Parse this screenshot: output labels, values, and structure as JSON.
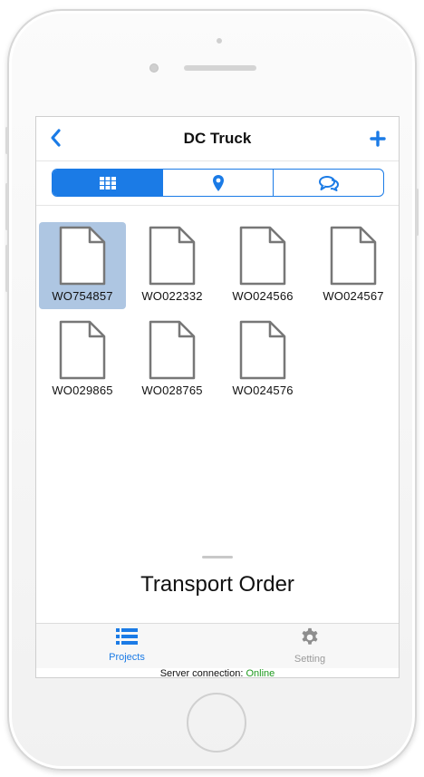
{
  "navbar": {
    "back_icon": "chevron-left-icon",
    "title": "DC Truck",
    "add_icon": "plus-icon"
  },
  "segments": [
    {
      "icon": "grid-icon",
      "active": true
    },
    {
      "icon": "map-pin-icon",
      "active": false
    },
    {
      "icon": "chat-bubbles-icon",
      "active": false
    }
  ],
  "documents": [
    {
      "label": "WO754857",
      "selected": true
    },
    {
      "label": "WO022332",
      "selected": false
    },
    {
      "label": "WO024566",
      "selected": false
    },
    {
      "label": "WO024567",
      "selected": false
    },
    {
      "label": "WO029865",
      "selected": false
    },
    {
      "label": "WO028765",
      "selected": false
    },
    {
      "label": "WO024576",
      "selected": false
    }
  ],
  "bottom_sheet": {
    "title": "Transport Order"
  },
  "tabbar": {
    "projects_label": "Projects",
    "setting_label": "Setting"
  },
  "status": {
    "prefix": "Server connection: ",
    "value": "Online"
  },
  "colors": {
    "accent": "#1b7be6",
    "selected_bg": "#aec6e2",
    "online": "#1e9a1e"
  }
}
